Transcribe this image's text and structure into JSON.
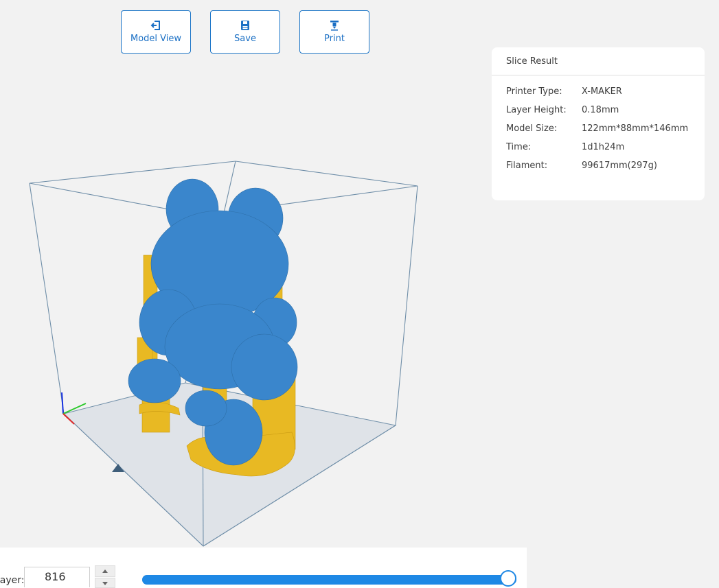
{
  "toolbar": {
    "model_view_label": "Model View",
    "save_label": "Save",
    "print_label": "Print",
    "icons": {
      "model_view": "exit-to-model-icon",
      "save": "floppy-disk-icon",
      "print": "nozzle-icon"
    }
  },
  "slice_result": {
    "title": "Slice Result",
    "rows": [
      {
        "key": "Printer Type:",
        "value": "X-MAKER"
      },
      {
        "key": "Layer Height:",
        "value": "0.18mm"
      },
      {
        "key": "Model Size:",
        "value": "122mm*88mm*146mm"
      },
      {
        "key": "Time:",
        "value": "1d1h24m"
      },
      {
        "key": "Filament:",
        "value": "99617mm(297g)"
      }
    ]
  },
  "layer_control": {
    "label": "Layer:",
    "value": "816",
    "slider_fraction": 1.0
  },
  "colors": {
    "accent": "#1a6fc4",
    "model": "#3a86cc",
    "support": "#e8b923",
    "build_plate": "#dfe3e8",
    "background": "#f2f2f2"
  }
}
